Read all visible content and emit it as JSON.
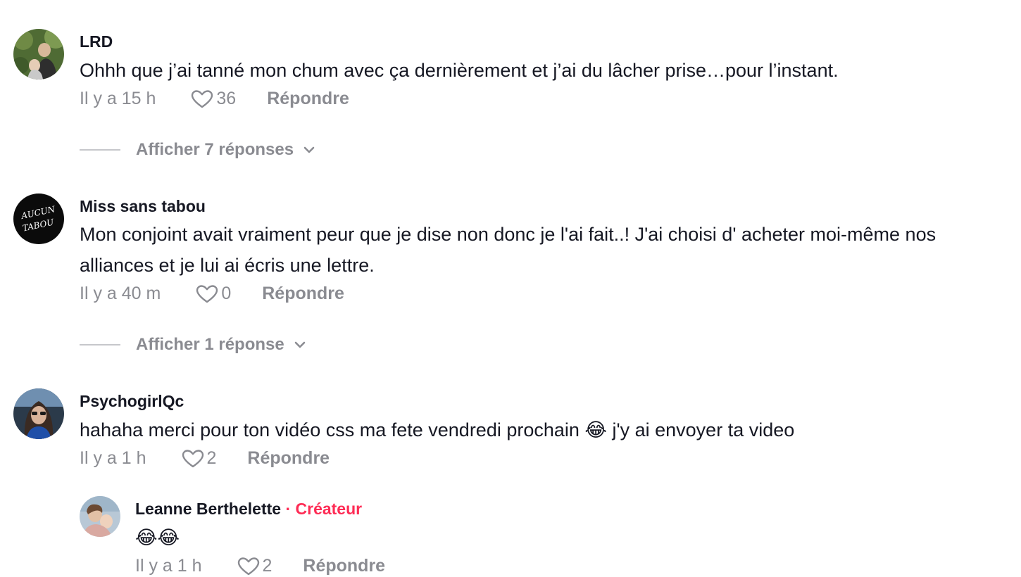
{
  "comments": [
    {
      "username": "LRD",
      "text": "Ohhh que j’ai tanné mon chum avec ça dernièrement et j’ai du lâcher prise…pour l’instant.",
      "time": "Il y a 15 h",
      "likes": "36",
      "reply_label": "Répondre",
      "replies_label": "Afficher 7 réponses"
    },
    {
      "username": "Miss sans tabou",
      "avatar_text_1": "AUCUN",
      "avatar_text_2": "TABOU",
      "text": "Mon conjoint avait vraiment peur que je dise non donc je l'ai fait..! J'ai choisi d' acheter moi-même nos alliances et je lui ai écris une lettre.",
      "time": "Il y a 40 m",
      "likes": "0",
      "reply_label": "Répondre",
      "replies_label": "Afficher 1 réponse"
    },
    {
      "username": "PsychogirlQc",
      "text": "hahaha merci pour ton vidéo css ma fete vendredi prochain 😂 j'y ai envoyer ta video",
      "time": "Il y a 1 h",
      "likes": "2",
      "reply_label": "Répondre"
    }
  ],
  "reply": {
    "username": "Leanne Berthelette",
    "badge": "· Créateur",
    "text": "😂😂",
    "time": "Il y a 1 h",
    "likes": "2",
    "reply_label": "Répondre"
  },
  "colors": {
    "text": "#161823",
    "muted": "#8a8b91",
    "creator": "#fe2c55"
  }
}
